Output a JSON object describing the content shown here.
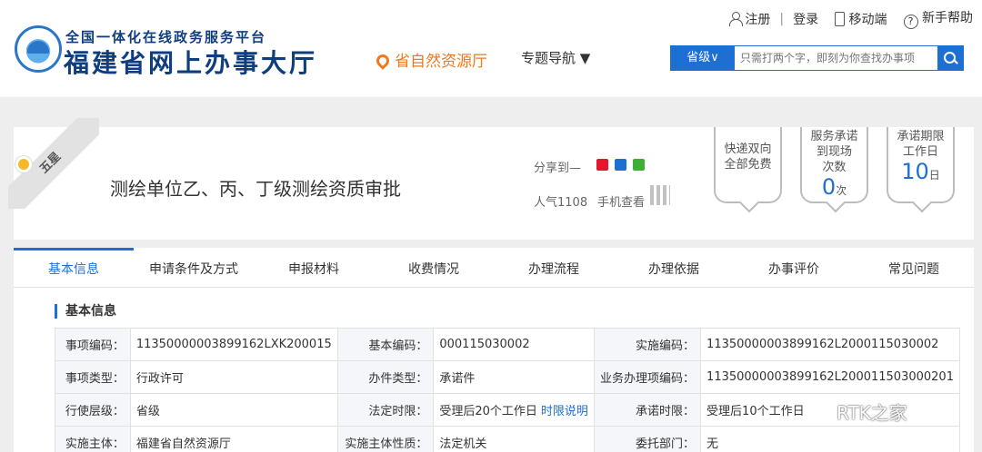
{
  "header": {
    "site_sub": "全国一体化在线政务服务平台",
    "site_main": "福建省网上办事大厅",
    "dept": "省自然资源厅",
    "topic_nav": "专题导航 ▼",
    "register": "注册",
    "login": "登录",
    "mobile": "移动端",
    "help": "新手帮助",
    "search": {
      "scope": "省级∨",
      "placeholder": "只需打两个字，即刻为你查找办事项"
    }
  },
  "title_panel": {
    "ribbon": "五星",
    "service_title": "测绘单位乙、丙、丁级测绘资质审批",
    "share_label": "分享到—",
    "popularity": "人气1108",
    "mobile_view": "手机查看",
    "badges": [
      {
        "line1": "快递双向",
        "line2": "全部免费"
      },
      {
        "line1": "服务承诺",
        "line2": "到现场",
        "line3": "次数",
        "big": "0",
        "unit": "次"
      },
      {
        "line1": "承诺期限",
        "line2": "工作日",
        "big": "10",
        "unit": "日"
      }
    ]
  },
  "tabs": [
    "基本信息",
    "申请条件及方式",
    "申报材料",
    "收费情况",
    "办理流程",
    "办理依据",
    "办事评价",
    "常见问题"
  ],
  "section_title": "基本信息",
  "info_rows": [
    [
      "事项编码：",
      "11350000003899162LXK200015",
      "基本编码：",
      "000115030002",
      "实施编码：",
      "11350000003899162L2000115030002"
    ],
    [
      "事项类型：",
      "行政许可",
      "办件类型：",
      "承诺件",
      "业务办理项编码：",
      "11350000003899162L200011503000201"
    ],
    [
      "行使层级：",
      "省级",
      "法定时限：",
      "受理后20个工作日",
      "承诺时限：",
      "受理后10个工作日"
    ],
    [
      "实施主体：",
      "福建省自然资源厅",
      "实施主体性质：",
      "法定机关",
      "委托部门：",
      "无"
    ]
  ],
  "time_link": "时限说明",
  "watermark": "RTK之家"
}
